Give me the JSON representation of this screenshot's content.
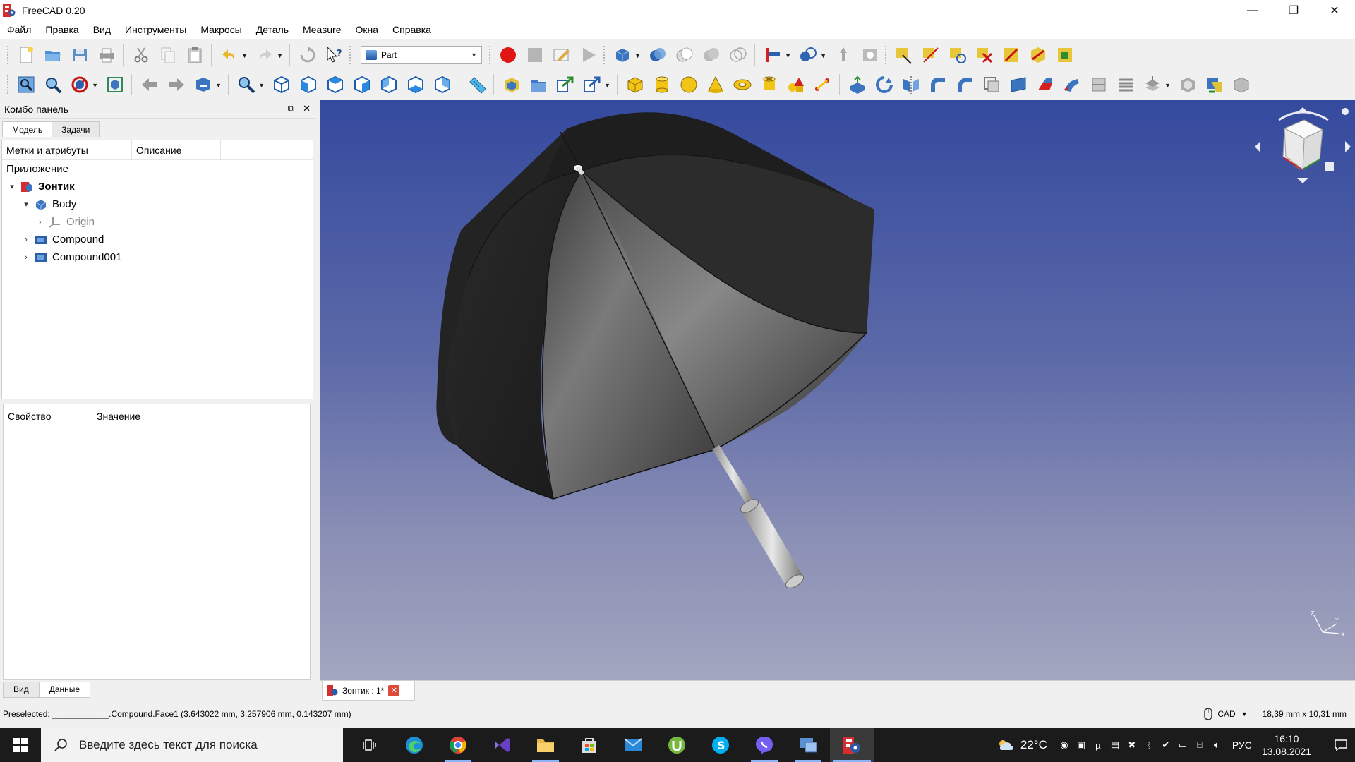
{
  "window": {
    "title": "FreeCAD 0.20",
    "minimize": "—",
    "maximize": "❐",
    "close": "✕"
  },
  "menu": [
    "Файл",
    "Правка",
    "Вид",
    "Инструменты",
    "Макросы",
    "Деталь",
    "Measure",
    "Окна",
    "Справка"
  ],
  "workbench": {
    "selected": "Part"
  },
  "combo": {
    "title": "Комбо панель",
    "tabs": [
      "Модель",
      "Задачи"
    ],
    "tree_headers": [
      "Метки и атрибуты",
      "Описание"
    ],
    "app_label": "Приложение",
    "items": [
      {
        "label": "Зонтик",
        "icon": "document-icon"
      },
      {
        "label": "Body",
        "icon": "body-icon"
      },
      {
        "label": "Origin",
        "icon": "origin-icon"
      },
      {
        "label": "Compound",
        "icon": "compound-icon"
      },
      {
        "label": "Compound001",
        "icon": "compound-icon"
      }
    ],
    "prop_headers": [
      "Свойство",
      "Значение"
    ],
    "bottom_tabs": [
      "Вид",
      "Данные"
    ]
  },
  "document_tab": {
    "label": "Зонтик : 1*"
  },
  "status": {
    "preselected": "Preselected: ____________.Compound.Face1 (3.643022 mm, 3.257906 mm, 0.143207 mm)",
    "nav_style": "CAD",
    "dimensions": "18,39 mm x 10,31 mm"
  },
  "taskbar": {
    "search_placeholder": "Введите здесь текст для поиска",
    "temperature": "22°C",
    "language": "РУС",
    "time": "16:10",
    "date": "13.08.2021"
  },
  "colors": {
    "view_bg_top": "#344a9e",
    "view_bg_bottom": "#a3a6bf",
    "umbrella_dark": "#1a1a1a",
    "umbrella_mid": "#4a4a4a",
    "taskbar_bg": "#1b1b1b"
  }
}
